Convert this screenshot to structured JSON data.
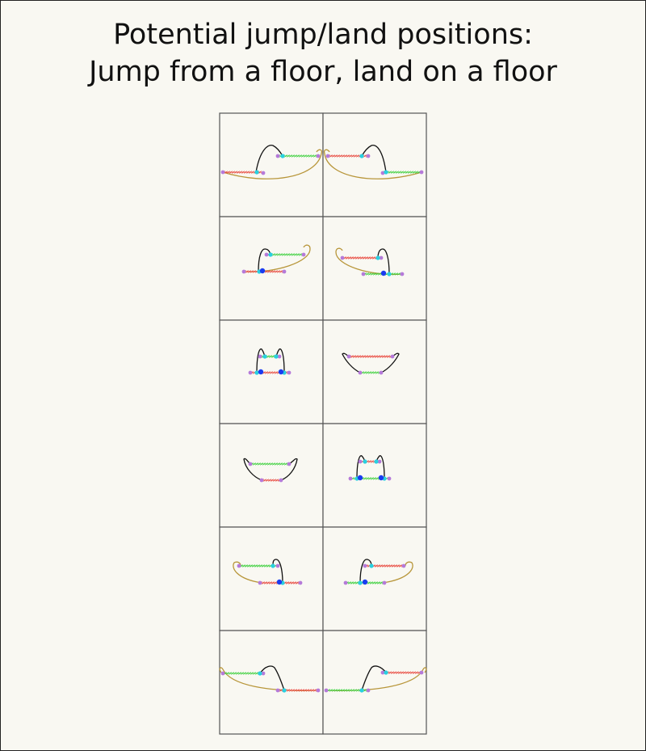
{
  "title": {
    "line1": "Potential jump/land positions:",
    "line2": "Jump from a floor, land on a floor"
  },
  "colors": {
    "background": "#f9f8f2",
    "grid_line": "#555555",
    "jump_surface": "#e8463c",
    "land_surface": "#3ccf3c",
    "trajectory": "#111111",
    "surface_arc": "#b8963a",
    "endpoint": "#b57ad9",
    "position": "#29d0e0",
    "jump_point": "#1a3cf0"
  },
  "grid": {
    "rows": 6,
    "cols": 2
  },
  "cells": [
    {
      "name": "cell-r1-c1",
      "icon": "jump-land-diagram-icon"
    },
    {
      "name": "cell-r1-c2",
      "icon": "jump-land-diagram-icon"
    },
    {
      "name": "cell-r2-c1",
      "icon": "jump-land-diagram-icon"
    },
    {
      "name": "cell-r2-c2",
      "icon": "jump-land-diagram-icon"
    },
    {
      "name": "cell-r3-c1",
      "icon": "jump-land-diagram-icon"
    },
    {
      "name": "cell-r3-c2",
      "icon": "jump-land-diagram-icon"
    },
    {
      "name": "cell-r4-c1",
      "icon": "jump-land-diagram-icon"
    },
    {
      "name": "cell-r4-c2",
      "icon": "jump-land-diagram-icon"
    },
    {
      "name": "cell-r5-c1",
      "icon": "jump-land-diagram-icon"
    },
    {
      "name": "cell-r5-c2",
      "icon": "jump-land-diagram-icon"
    },
    {
      "name": "cell-r6-c1",
      "icon": "jump-land-diagram-icon"
    },
    {
      "name": "cell-r6-c2",
      "icon": "jump-land-diagram-icon"
    }
  ]
}
